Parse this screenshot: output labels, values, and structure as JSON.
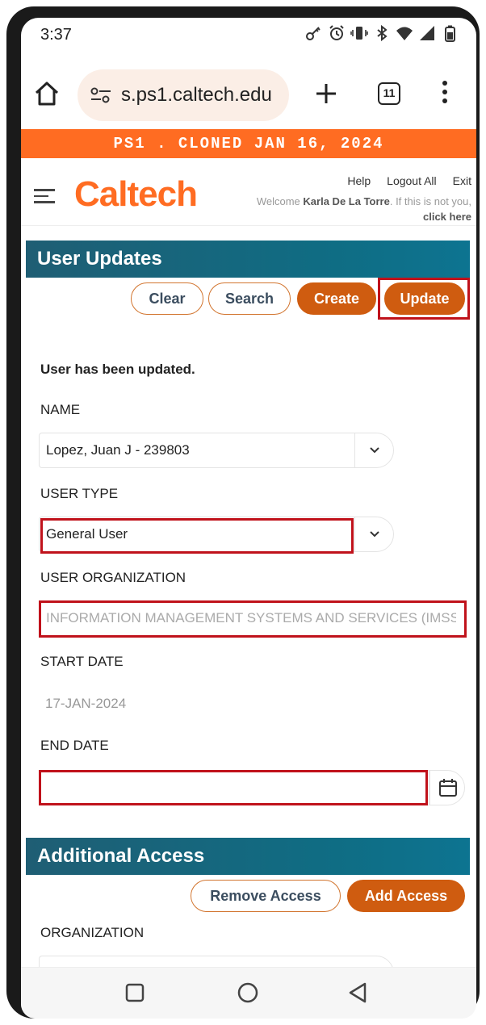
{
  "status_bar": {
    "time": "3:37",
    "icons": [
      "key-icon",
      "alarm-icon",
      "vibrate-icon",
      "bluetooth-icon",
      "wifi-icon",
      "signal-icon",
      "battery-icon"
    ]
  },
  "browser": {
    "url": "s.ps1.caltech.edu",
    "tab_count": "11",
    "icons": [
      "home-icon",
      "site-settings-icon",
      "new-tab-icon",
      "tabs-icon",
      "overflow-menu-icon"
    ]
  },
  "env_banner": "PS1 . CLONED JAN 16, 2024",
  "header": {
    "logo": "Caltech",
    "links": {
      "help": "Help",
      "logout": "Logout All",
      "exit": "Exit"
    },
    "welcome_prefix": "Welcome",
    "user_name": "Karla De La Torre",
    "welcome_middle": ". If this is not you,",
    "click_here": "click here"
  },
  "user_updates": {
    "title": "User Updates",
    "buttons": {
      "clear": "Clear",
      "search": "Search",
      "create": "Create",
      "update": "Update"
    },
    "message": "User has been updated.",
    "fields": {
      "name": {
        "label": "NAME",
        "value": "Lopez, Juan J - 239803"
      },
      "user_type": {
        "label": "USER TYPE",
        "value": "General User"
      },
      "user_org": {
        "label": "USER ORGANIZATION",
        "value": "INFORMATION MANAGEMENT SYSTEMS AND SERVICES (IMSS)"
      },
      "start_date": {
        "label": "START DATE",
        "value": "17-JAN-2024"
      },
      "end_date": {
        "label": "END DATE",
        "value": ""
      }
    }
  },
  "additional_access": {
    "title": "Additional Access",
    "buttons": {
      "remove": "Remove Access",
      "add": "Add Access"
    },
    "org_label": "ORGANIZATION"
  },
  "colors": {
    "brand_orange": "#ff6c22",
    "button_orange": "#cf5c10",
    "section_teal": "#0f6d84",
    "highlight_red": "#c0121b"
  }
}
